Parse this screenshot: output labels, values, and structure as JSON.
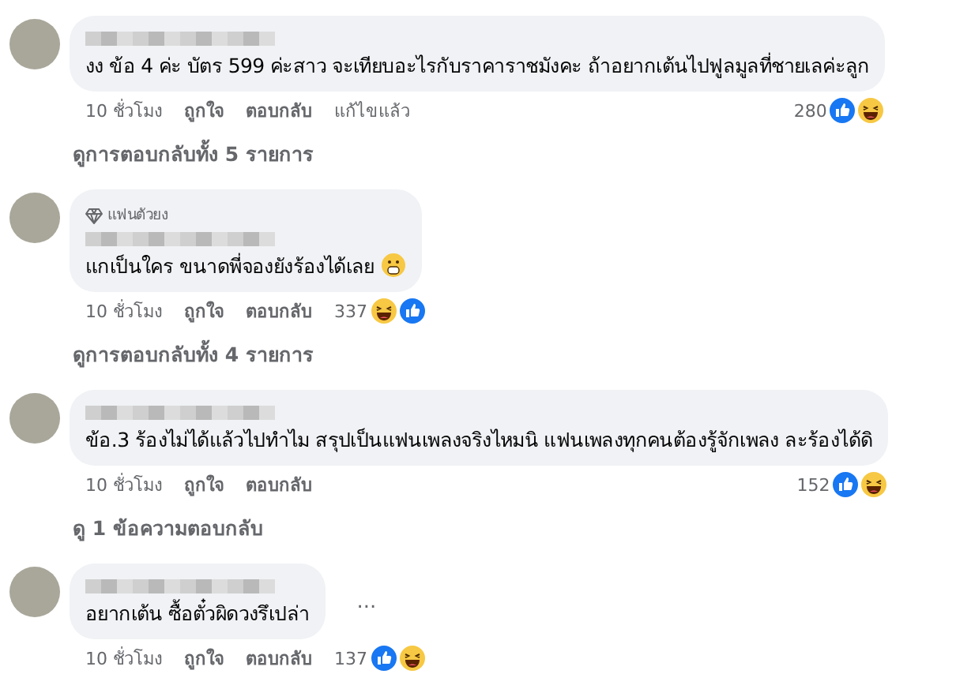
{
  "comments": [
    {
      "text": "งง ข้อ 4 ค่ะ บัตร 599 ค่ะสาว จะเทียบอะไรกับราคาราชมังคะ ถ้าอยากเต้นไปฟูลมูลที่ชายเลค่ะลูก",
      "time": "10 ชั่วโมง",
      "like": "ถูกใจ",
      "reply": "ตอบกลับ",
      "edited": "แก้ไขแล้ว",
      "count": "280",
      "reactions": [
        {
          "kind": "like"
        },
        {
          "kind": "haha"
        }
      ],
      "view_replies": "ดูการตอบกลับทั้ง 5 รายการ"
    },
    {
      "badge": "แฟนตัวยง",
      "text": "แกเป็นใคร ขนาดพี่จองยังร้องได้เลย",
      "emoji": true,
      "time": "10 ชั่วโมง",
      "like": "ถูกใจ",
      "reply": "ตอบกลับ",
      "count": "337",
      "reactions": [
        {
          "kind": "haha"
        },
        {
          "kind": "like"
        }
      ],
      "view_replies": "ดูการตอบกลับทั้ง 4 รายการ"
    },
    {
      "text": "ข้อ.3 ร้องไม่ได้แล้วไปทำไม สรุปเป็นแฟนเพลงจริงไหมนิ แฟนเพลงทุกคนต้องรู้จักเพลง ละร้องได้ดิ",
      "time": "10 ชั่วโมง",
      "like": "ถูกใจ",
      "reply": "ตอบกลับ",
      "count": "152",
      "reactions": [
        {
          "kind": "like"
        },
        {
          "kind": "haha"
        }
      ],
      "view_replies": "ดู 1 ข้อความตอบกลับ"
    },
    {
      "text": "อยากเต้น ซื้อตั๋วผิดวงรึเปล่า",
      "menu": "...",
      "time": "10 ชั่วโมง",
      "like": "ถูกใจ",
      "reply": "ตอบกลับ",
      "count": "137",
      "reactions": [
        {
          "kind": "like"
        },
        {
          "kind": "haha"
        }
      ]
    }
  ]
}
